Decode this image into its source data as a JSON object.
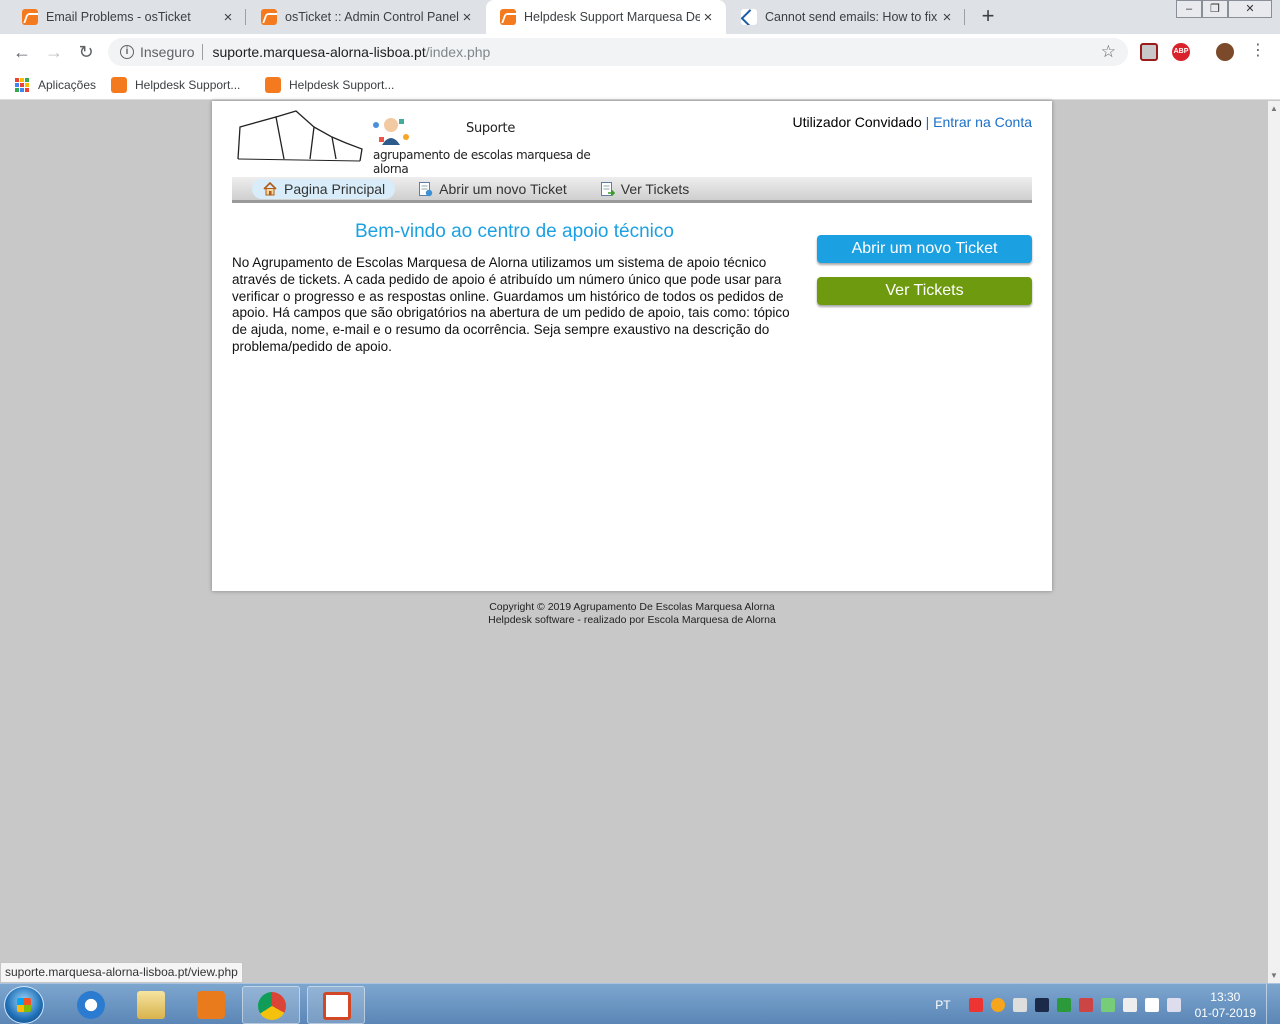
{
  "browser": {
    "tabs": [
      {
        "title": "Email Problems - osTicket",
        "active": false
      },
      {
        "title": "osTicket :: Admin Control Panel",
        "active": false
      },
      {
        "title": "Helpdesk Support Marquesa De A",
        "active": true
      },
      {
        "title": "Cannot send emails: How to fix e",
        "active": false
      }
    ],
    "close_glyph": "×",
    "new_tab_glyph": "+",
    "window_controls": {
      "minimize": "–",
      "restore": "❐",
      "close": "✕"
    },
    "nav": {
      "back": "←",
      "forward": "→",
      "reload": "↻"
    },
    "address": {
      "security_label": "Inseguro",
      "host": "suporte.marquesa-alorna-lisboa.pt",
      "path": "/index.php",
      "bookmark_star": "☆"
    },
    "menu_glyph": "⋮",
    "bookmarks": [
      {
        "label": "Aplicações",
        "icon": "apps-grid-icon"
      },
      {
        "label": "Helpdesk Support...",
        "icon": "osticket-icon"
      },
      {
        "label": "Helpdesk Support...",
        "icon": "osticket-icon"
      }
    ],
    "status_url": "suporte.marquesa-alorna-lisboa.pt/view.php"
  },
  "site": {
    "logo": {
      "title": "Suporte",
      "school": "agrupamento de escolas marquesa de alorna"
    },
    "user": {
      "guest": "Utilizador Convidado",
      "separator": "|",
      "login": "Entrar na Conta"
    },
    "nav": [
      {
        "label": "Pagina Principal",
        "icon": "home-icon",
        "active": true
      },
      {
        "label": "Abrir um novo Ticket",
        "icon": "new-ticket-icon",
        "active": false
      },
      {
        "label": "Ver Tickets",
        "icon": "view-tickets-icon",
        "active": false
      }
    ],
    "welcome_title": "Bem-vindo ao centro de apoio técnico",
    "intro": "No Agrupamento de Escolas Marquesa de Alorna utilizamos um sistema de apoio técnico através de tickets. A cada pedido de apoio é atribuído um número único que pode usar para verificar o progresso e as respostas online. Guardamos um histórico de todos os pedidos de apoio. Há campos que são obrigatórios na abertura de um pedido de apoio, tais como: tópico de ajuda, nome, e-mail e o resumo da ocorrência. Seja sempre exaustivo na descrição do problema/pedido de apoio.",
    "buttons": {
      "open_ticket": "Abrir um novo Ticket",
      "view_tickets": "Ver Tickets"
    },
    "footer": {
      "copyright": "Copyright © 2019 Agrupamento De Escolas Marquesa Alorna",
      "credit": "Helpdesk software - realizado por Escola Marquesa de Alorna"
    },
    "colors": {
      "accent_blue": "#1ba1e2",
      "accent_green": "#6e9a0f",
      "link": "#1a6fc7"
    }
  },
  "taskbar": {
    "apps": [
      "internet-explorer-icon",
      "file-explorer-icon",
      "media-player-icon",
      "chrome-icon",
      "powerpoint-icon"
    ],
    "language": "PT",
    "time": "13:30",
    "date": "01-07-2019"
  }
}
